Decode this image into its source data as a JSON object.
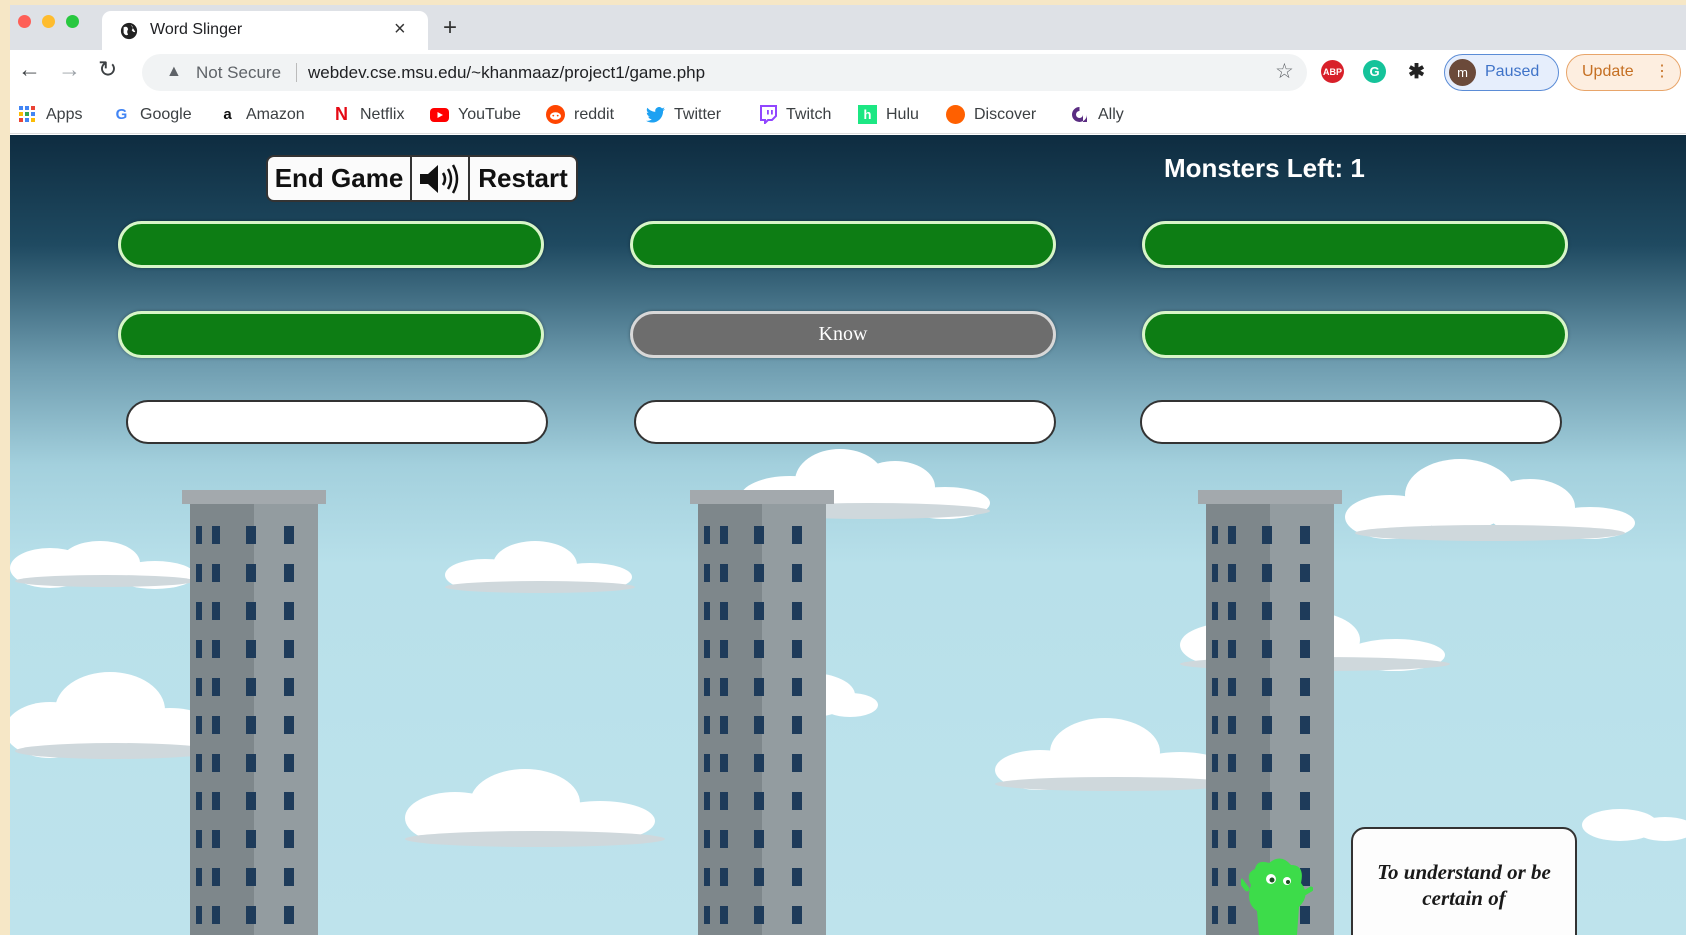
{
  "browser": {
    "tab": {
      "title": "Word Slinger",
      "close": "×",
      "new_tab": "+"
    },
    "toolbar": {
      "security": "Not Secure",
      "url": "webdev.cse.msu.edu/~khanmaaz/project1/game.php",
      "profile_initial": "m",
      "profile_status": "Paused",
      "update_label": "Update"
    },
    "bookmarks": [
      {
        "label": "Apps",
        "icon": "apps-grid-icon",
        "color": "#4285f4"
      },
      {
        "label": "Google",
        "icon": "google-icon",
        "color": "#4285f4"
      },
      {
        "label": "Amazon",
        "icon": "amazon-icon",
        "color": "#111111"
      },
      {
        "label": "Netflix",
        "icon": "netflix-icon",
        "color": "#e50914"
      },
      {
        "label": "YouTube",
        "icon": "youtube-icon",
        "color": "#ff0000"
      },
      {
        "label": "reddit",
        "icon": "reddit-icon",
        "color": "#ff4500"
      },
      {
        "label": "Twitter",
        "icon": "twitter-icon",
        "color": "#1da1f2"
      },
      {
        "label": "Twitch",
        "icon": "twitch-icon",
        "color": "#9146ff"
      },
      {
        "label": "Hulu",
        "icon": "hulu-icon",
        "color": "#1ce783"
      },
      {
        "label": "Discover",
        "icon": "discover-icon",
        "color": "#ff6000"
      },
      {
        "label": "Ally",
        "icon": "ally-icon",
        "color": "#5a2d82"
      }
    ]
  },
  "game": {
    "buttons": {
      "end_game": "End Game",
      "restart": "Restart",
      "sound_icon": "speaker-icon"
    },
    "monsters_left": "Monsters Left: 1",
    "word_slots": [
      {
        "text": "",
        "state": "hidden"
      },
      {
        "text": "",
        "state": "hidden"
      },
      {
        "text": "",
        "state": "hidden"
      },
      {
        "text": "",
        "state": "hidden"
      },
      {
        "text": "Know",
        "state": "revealed"
      },
      {
        "text": "",
        "state": "hidden"
      }
    ],
    "answer_inputs": [
      {
        "value": "",
        "placeholder": ""
      },
      {
        "value": "",
        "placeholder": ""
      },
      {
        "value": "",
        "placeholder": ""
      }
    ],
    "definition": "To understand or be certain of",
    "colors": {
      "slot_hidden": "#0d7d14",
      "slot_revealed": "#6d6d6d",
      "monster": "#3ddc4a"
    }
  }
}
